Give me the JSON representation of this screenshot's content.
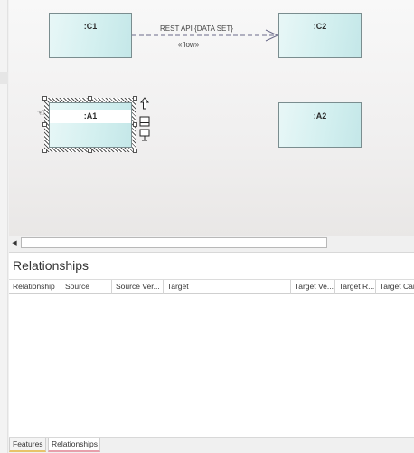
{
  "diagram": {
    "elements": {
      "c1": ":C1",
      "c2": ":C2",
      "a1": ":A1",
      "a2": ":A2"
    },
    "connector": {
      "label": "REST API {DATA SET}",
      "stereotype": "«flow»"
    },
    "toolbar_icons": [
      "up-arrow-icon",
      "list-icon",
      "connector-icon"
    ]
  },
  "relationships": {
    "title": "Relationships",
    "columns": [
      "Relationship",
      "Source",
      "Source Ver...",
      "Target",
      "Target Ve...",
      "Target R...",
      "Target Car"
    ]
  },
  "tabs": [
    "Features",
    "Relationships"
  ],
  "colors": {
    "element_fill": "#d2efef",
    "features_tab_underline": "#e8c46a",
    "relationships_tab_underline": "#e7a0ac"
  }
}
